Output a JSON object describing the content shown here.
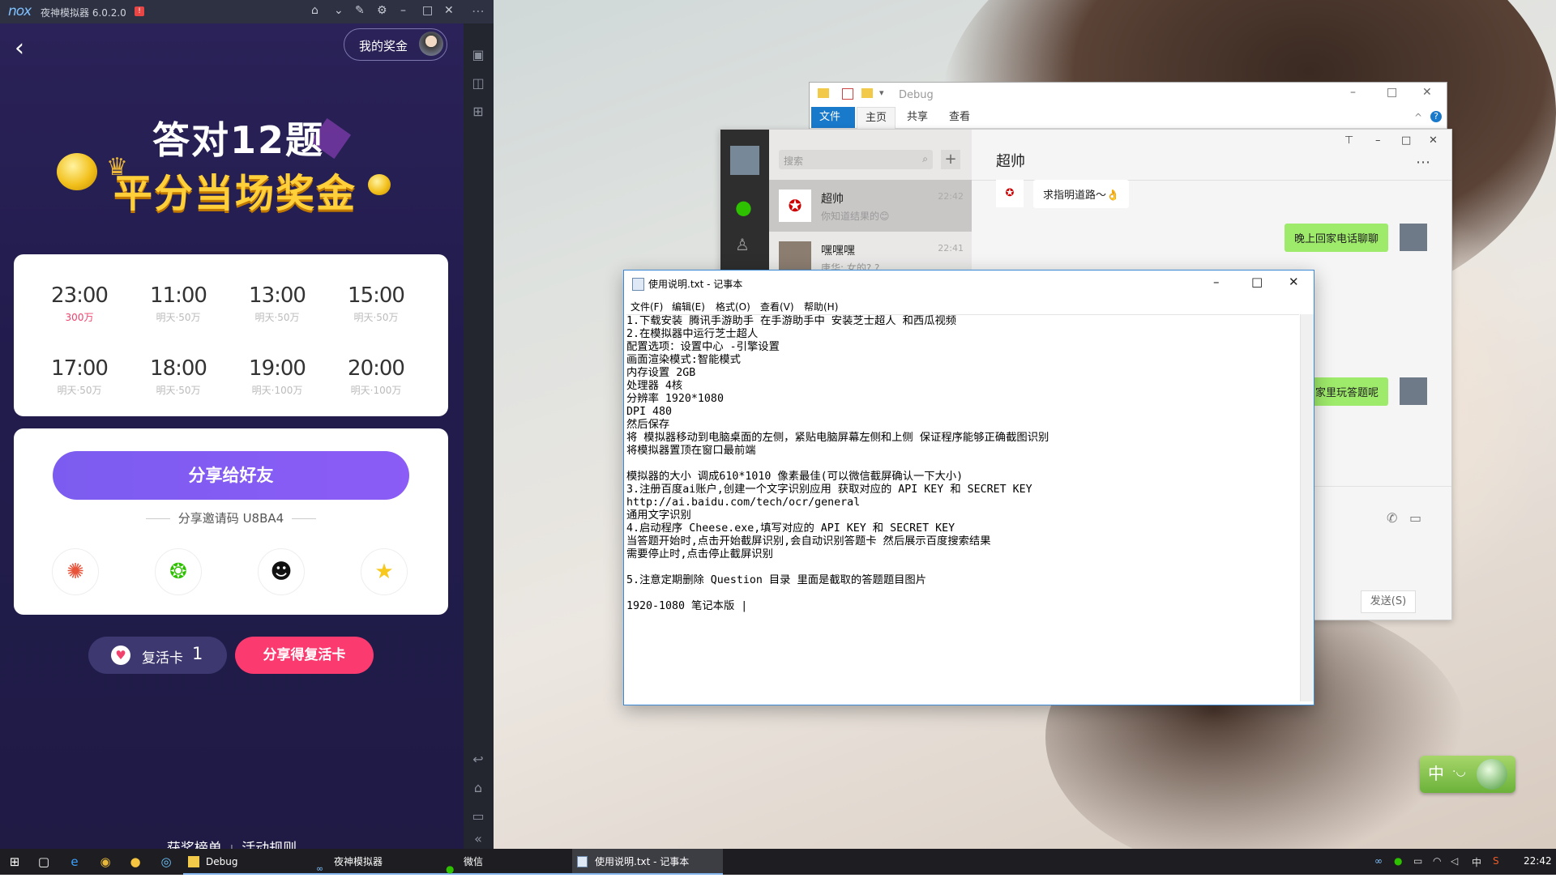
{
  "emulator": {
    "logo": "nox",
    "title": "夜神模拟器 6.0.2.0",
    "badge": "!",
    "my_prize": "我的奖金",
    "headline1": "答对12题",
    "headline2": "平分当场奖金",
    "schedule": [
      {
        "time": "23:00",
        "sub": "300万"
      },
      {
        "time": "11:00",
        "sub": "明天·50万"
      },
      {
        "time": "13:00",
        "sub": "明天·50万"
      },
      {
        "time": "15:00",
        "sub": "明天·50万"
      },
      {
        "time": "17:00",
        "sub": "明天·50万"
      },
      {
        "time": "18:00",
        "sub": "明天·50万"
      },
      {
        "time": "19:00",
        "sub": "明天·100万"
      },
      {
        "time": "20:00",
        "sub": "明天·100万"
      }
    ],
    "share_button": "分享给好友",
    "invite_code": "分享邀请码 U8BA4",
    "share_targets": [
      "moments-icon",
      "wechat-icon",
      "qq-icon",
      "qzone-icon"
    ],
    "revive_label": "复活卡",
    "revive_count": "1",
    "get_revive": "分享得复活卡",
    "footer_links": [
      "获奖榜单",
      "活动规则"
    ]
  },
  "explorer": {
    "title": "Debug",
    "tabs": [
      "文件",
      "主页",
      "共享",
      "查看"
    ]
  },
  "wechat": {
    "search_placeholder": "搜索",
    "chats": [
      {
        "name": "超帅",
        "preview": "你知道结果的😊",
        "time": "22:42"
      },
      {
        "name": "嘿嘿嘿",
        "preview": "唐华: 女的? ?",
        "time": "22:41"
      }
    ],
    "chat_title": "超帅",
    "messages": [
      {
        "side": "left",
        "text": "求指明道路～👌"
      },
      {
        "side": "right",
        "text": "晚上回家电话聊聊"
      },
      {
        "side": "right",
        "text": "家里玩答题呢"
      }
    ],
    "send_label": "发送(S)"
  },
  "notepad": {
    "title": "使用说明.txt - 记事本",
    "menu": [
      "文件(F)",
      "编辑(E)",
      "格式(O)",
      "查看(V)",
      "帮助(H)"
    ],
    "lines": [
      "1.下载安装 腾讯手游助手 在手游助手中 安装芝士超人 和西瓜视频",
      "2.在模拟器中运行芝士超人",
      "配置选项：设置中心 -引擎设置",
      "画面渲染模式:智能模式",
      "内存设置 2GB",
      "处理器 4核",
      "分辨率 1920*1080",
      "DPI 480",
      "然后保存",
      "将 模拟器移动到电脑桌面的左侧，紧贴电脑屏幕左侧和上侧 保证程序能够正确截图识别",
      "将模拟器置顶在窗口最前端",
      "",
      "模拟器的大小 调成610*1010 像素最佳(可以微信截屏确认一下大小)",
      "3.注册百度ai账户,创建一个文字识别应用 获取对应的 API KEY 和 SECRET KEY",
      "http://ai.baidu.com/tech/ocr/general",
      "通用文字识别",
      "4.启动程序 Cheese.exe,填写对应的 API KEY 和 SECRET KEY",
      "当答题开始时,点击开始截屏识别,会自动识别答题卡 然后展示百度搜索结果",
      "需要停止时,点击停止截屏识别",
      "",
      "5.注意定期删除 Question 目录 里面是截取的答题题目图片",
      "",
      "1920-1080 笔记本版 |"
    ]
  },
  "ime": {
    "label": "中"
  },
  "taskbar": {
    "apps": [
      {
        "label": "Debug"
      },
      {
        "label": "夜神模拟器"
      },
      {
        "label": "微信"
      },
      {
        "label": "使用说明.txt - 记事本"
      }
    ],
    "tray_lang": "中",
    "time": "22:42"
  },
  "colors": {
    "emulator_bg": "#221c4d",
    "accent_purple": "#8b5cf6",
    "accent_pink": "#fb3a6f",
    "wechat_bubble": "#9eea6a",
    "explorer_file_tab": "#1979ca"
  }
}
